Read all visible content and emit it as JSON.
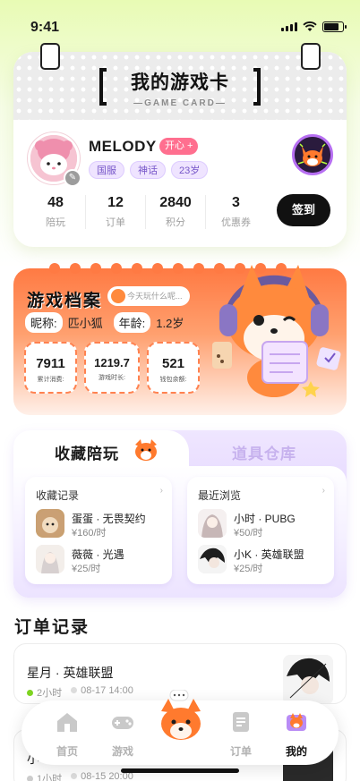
{
  "status": {
    "time": "9:41"
  },
  "game_card": {
    "title": "我的游戏卡",
    "subtitle": "—GAME CARD—",
    "username": "MELODY",
    "mood": "开心 +",
    "tags": [
      "国服",
      "神话",
      "23岁"
    ],
    "stats": [
      {
        "value": "48",
        "label": "陪玩"
      },
      {
        "value": "12",
        "label": "订单"
      },
      {
        "value": "2840",
        "label": "积分"
      },
      {
        "value": "3",
        "label": "优惠券"
      }
    ],
    "signin_label": "签到"
  },
  "profile": {
    "title": "游戏档案",
    "ask": "今天玩什么呢...",
    "nickname_label": "昵称:",
    "nickname": "匹小狐",
    "age_label": "年龄:",
    "age": "1.2岁",
    "boxes": [
      {
        "value": "7911",
        "label": "累计消费:"
      },
      {
        "value": "1219.7",
        "label": "游戏时长:"
      },
      {
        "value": "521",
        "label": "钱包余额:"
      }
    ]
  },
  "collect": {
    "tab_active": "收藏陪玩",
    "tab_inactive": "道具仓库",
    "left": {
      "header": "收藏记录",
      "items": [
        {
          "name": "蛋蛋 · 无畏契约",
          "price": "¥160/时"
        },
        {
          "name": "薇薇 · 光遇",
          "price": "¥25/时"
        }
      ]
    },
    "right": {
      "header": "最近浏览",
      "items": [
        {
          "name": "小时 · PUBG",
          "price": "¥50/时"
        },
        {
          "name": "小K · 英雄联盟",
          "price": "¥25/时"
        }
      ]
    }
  },
  "orders": {
    "title": "订单记录",
    "items": [
      {
        "name": "星月 · 英雄联盟",
        "duration": "2小时",
        "date": "08-17 14:00"
      },
      {
        "name": "小",
        "duration": "1小时",
        "date": "08-15 20:00"
      }
    ]
  },
  "nav": {
    "items": [
      "首页",
      "游戏",
      "",
      "订单",
      "我的"
    ]
  },
  "colors": {
    "accent_pink": "#ff6f8f",
    "profile_orange": "#ff7a43",
    "tag_purple": "#7656c8",
    "online_green": "#7ed321"
  }
}
